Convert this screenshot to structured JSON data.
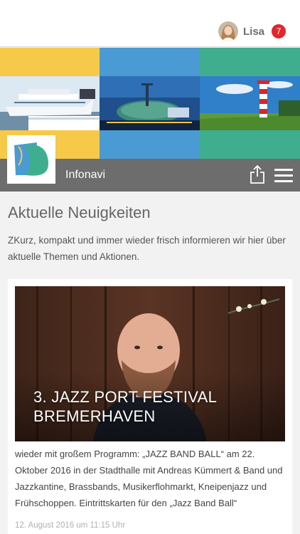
{
  "user": {
    "name": "Lisa",
    "notification_count": "7"
  },
  "appbar": {
    "title": "Infonavi"
  },
  "section": {
    "title": "Aktuelle Neuigkeiten",
    "intro": "ZKurz, kompakt und immer wieder frisch informieren wir hier über aktuelle Themen und Aktionen."
  },
  "news": [
    {
      "title": "3. JAZZ PORT FESTIVAL BREMERHAVEN",
      "text": "wieder mit großem Programm: „JAZZ BAND BALL“ am 22. Oktober 2016 in der Stadthalle mit Andreas Kümmert & Band und Jazzkantine, Brassbands, Musikerflohmarkt, Kneipenjazz und Frühschoppen. Eintrittskarten für den „Jazz Band Ball“",
      "date": "12. August 2016 um 11:15 Uhr"
    }
  ],
  "colors": {
    "banner_yellow": "#f7c948",
    "banner_blue": "#4a9bd4",
    "banner_teal": "#3fae8f",
    "appbar_gray": "#6d6d6d",
    "badge_red": "#e2262b"
  },
  "icons": [
    "avatar",
    "share-icon",
    "hamburger-menu-icon",
    "app-logo"
  ]
}
